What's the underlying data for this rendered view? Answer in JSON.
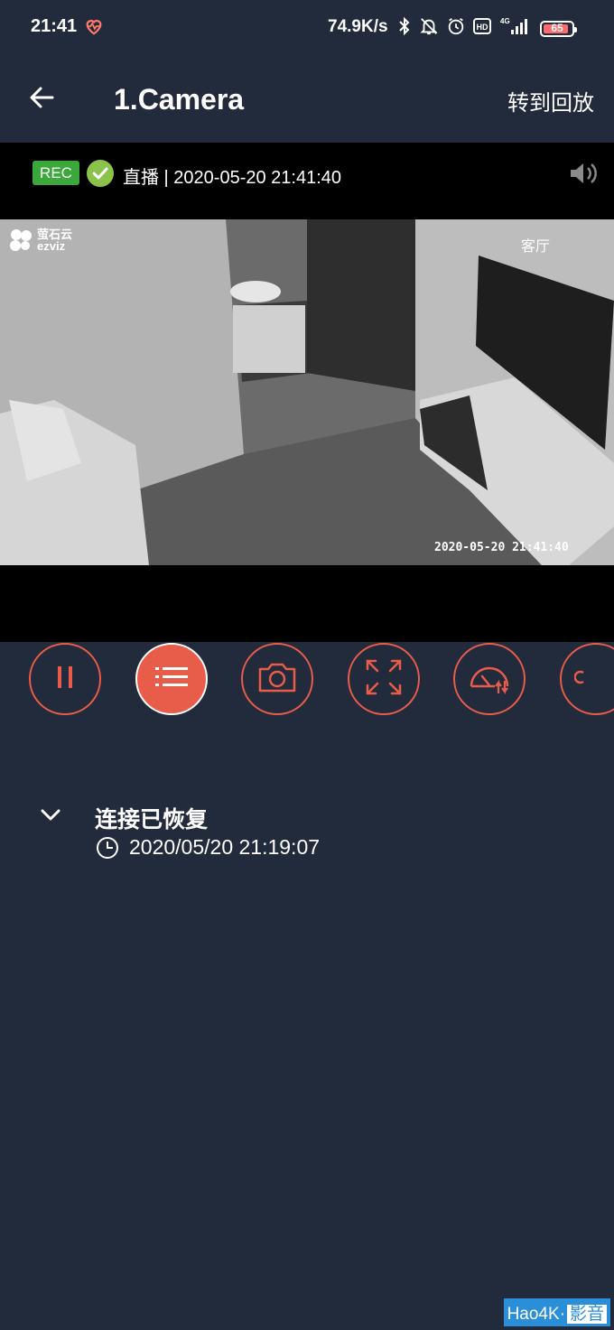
{
  "status_bar": {
    "time": "21:41",
    "network_speed": "74.9K/s",
    "network_type": "4G",
    "battery_level": "65",
    "icons": [
      "heart-rate-icon",
      "bluetooth-icon",
      "mute-icon",
      "alarm-icon",
      "hd-icon",
      "signal-icon",
      "battery-icon"
    ]
  },
  "nav": {
    "title": "1.Camera",
    "playback_label": "转到回放"
  },
  "live": {
    "rec_label": "REC",
    "status_text": "直播 | 2020-05-20 21:41:40"
  },
  "feed": {
    "brand_cn": "萤石云",
    "brand_en": "ezviz",
    "room_label": "客厅",
    "osd_timestamp": "2020-05-20  21:41:40"
  },
  "controls": [
    "pause",
    "event-list",
    "screenshot",
    "fullscreen",
    "quality",
    "more"
  ],
  "events": [
    {
      "title": "连接已恢复",
      "time": "2020/05/20 21:19:07"
    }
  ],
  "watermark": {
    "part1": "Hao4K·",
    "part2": "影音"
  },
  "colors": {
    "background": "#222b3b",
    "accent": "#e85c4a",
    "rec_green": "#3aa83a",
    "check_green": "#8bc34a"
  }
}
